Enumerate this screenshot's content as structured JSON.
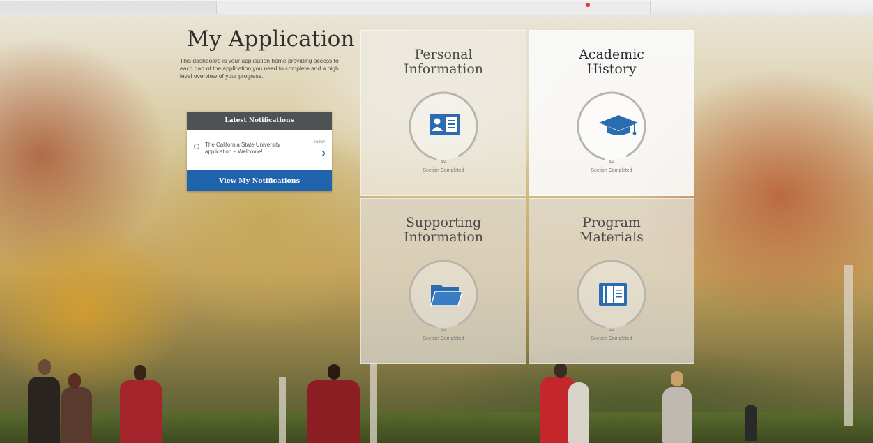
{
  "page": {
    "title": "My Application",
    "intro": "This dashboard is your application home providing access to each part of the application you need to complete and a high level overview of your progress."
  },
  "notifications": {
    "header": "Latest Notifications",
    "items": [
      {
        "text": "The California State University application – Welcome!",
        "time": "Today"
      }
    ],
    "view_button": "View My Notifications"
  },
  "tiles": [
    {
      "title_line1": "Personal",
      "title_line2": "Information",
      "icon": "id-card-icon",
      "count": "4/4",
      "status": "Section Completed"
    },
    {
      "title_line1": "Academic",
      "title_line2": "History",
      "icon": "graduation-cap-icon",
      "count": "4/4",
      "status": "Section Completed"
    },
    {
      "title_line1": "Supporting",
      "title_line2": "Information",
      "icon": "folder-icon",
      "count": "4/4",
      "status": "Section Completed"
    },
    {
      "title_line1": "Program",
      "title_line2": "Materials",
      "icon": "book-icon",
      "count": "4/4",
      "status": "Section Completed"
    }
  ],
  "colors": {
    "accent": "#1f63ad",
    "icon": "#2b6cb0",
    "notif_header": "#4f5255"
  }
}
